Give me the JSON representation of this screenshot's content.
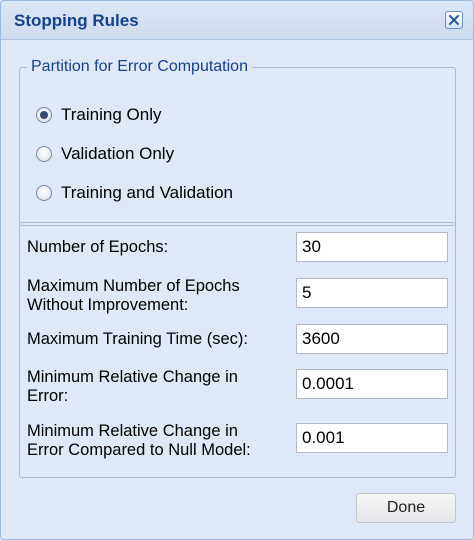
{
  "dialog": {
    "title": "Stopping Rules",
    "close_icon": "close-x-icon"
  },
  "partition": {
    "legend": "Partition for Error Computation",
    "options": [
      {
        "label": "Training Only",
        "checked": true
      },
      {
        "label": "Validation Only",
        "checked": false
      },
      {
        "label": "Training and Validation",
        "checked": false
      }
    ]
  },
  "fields": [
    {
      "label": "Number of Epochs:",
      "value": "30"
    },
    {
      "label": "Maximum Number of Epochs Without Improvement:",
      "value": "5"
    },
    {
      "label": "Maximum Training Time (sec):",
      "value": "3600"
    },
    {
      "label": "Minimum Relative Change in Error:",
      "value": "0.0001"
    },
    {
      "label": "Minimum Relative Change in Error Compared to Null Model:",
      "value": "0.001"
    }
  ],
  "buttons": {
    "done": "Done"
  },
  "colors": {
    "title": "#15428b",
    "background": "#dfe8f6",
    "border": "#99bbe8"
  }
}
